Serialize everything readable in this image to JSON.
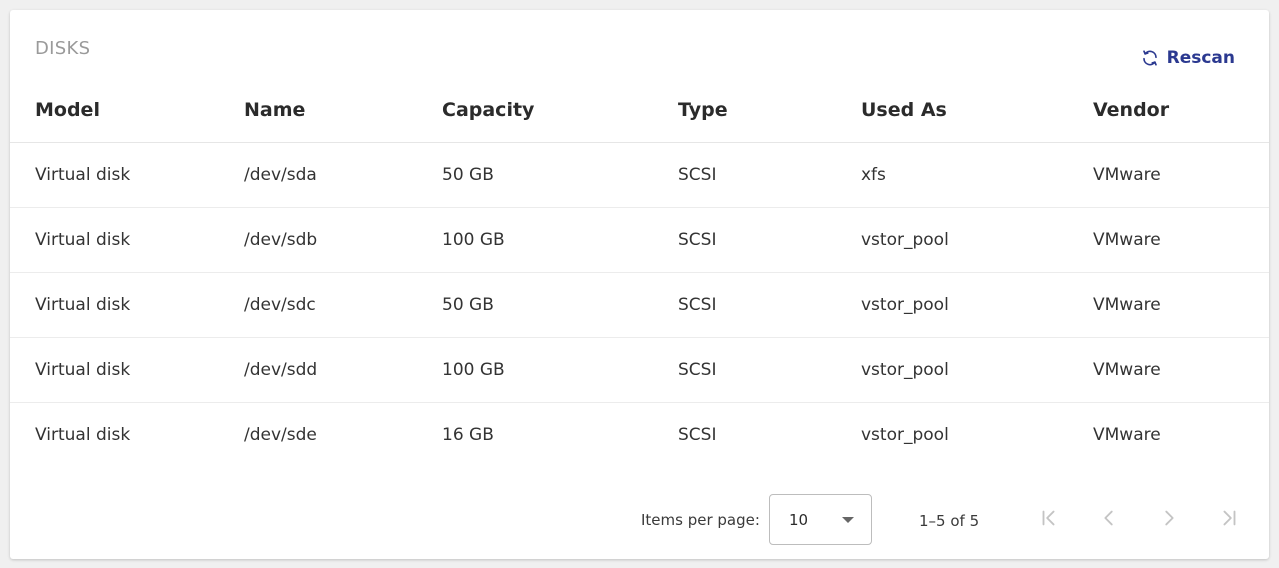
{
  "card": {
    "title": "DISKS",
    "rescan_label": "Rescan"
  },
  "table": {
    "columns": [
      "Model",
      "Name",
      "Capacity",
      "Type",
      "Used As",
      "Vendor"
    ],
    "rows": [
      [
        "Virtual disk",
        "/dev/sda",
        "50 GB",
        "SCSI",
        "xfs",
        "VMware"
      ],
      [
        "Virtual disk",
        "/dev/sdb",
        "100 GB",
        "SCSI",
        "vstor_pool",
        "VMware"
      ],
      [
        "Virtual disk",
        "/dev/sdc",
        "50 GB",
        "SCSI",
        "vstor_pool",
        "VMware"
      ],
      [
        "Virtual disk",
        "/dev/sdd",
        "100 GB",
        "SCSI",
        "vstor_pool",
        "VMware"
      ],
      [
        "Virtual disk",
        "/dev/sde",
        "16 GB",
        "SCSI",
        "vstor_pool",
        "VMware"
      ]
    ]
  },
  "paginator": {
    "items_per_page_label": "Items per page:",
    "items_per_page_value": "10",
    "range_label": "1–5 of 5",
    "first_icon": "first-page-icon",
    "prev_icon": "chevron-left-icon",
    "next_icon": "chevron-right-icon",
    "last_icon": "last-page-icon"
  },
  "colors": {
    "accent": "#2b3990",
    "title_gray": "#9a9a9a",
    "disabled_icon": "#c4c4c4"
  }
}
